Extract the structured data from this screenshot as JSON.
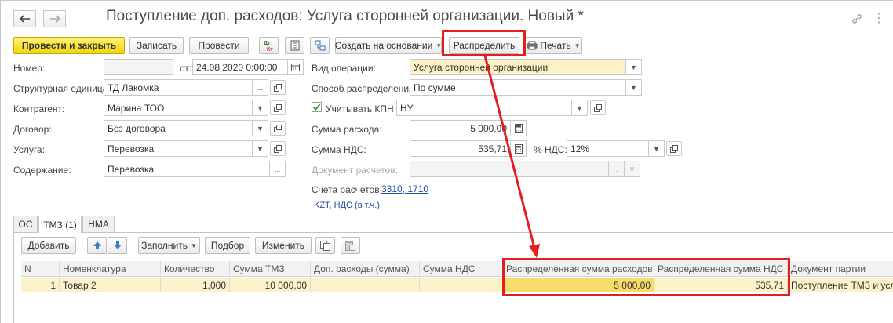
{
  "window": {
    "title": "Поступление доп. расходов: Услуга сторонней организации. Новый *"
  },
  "toolbar": {
    "post_close_label": "Провести и закрыть",
    "save_label": "Записать",
    "post_label": "Провести",
    "create_based_label": "Создать на основании",
    "distribute_label": "Распределить",
    "print_label": "Печать"
  },
  "form": {
    "number": {
      "label": "Номер:",
      "value": ""
    },
    "date": {
      "label": "от:",
      "value": "24.08.2020  0:00:00"
    },
    "structural_unit": {
      "label": "Структурная единица:",
      "value": "ТД Лакомка"
    },
    "counterparty": {
      "label": "Контрагент:",
      "value": "Марина ТОО"
    },
    "contract": {
      "label": "Договор:",
      "value": "Без договора"
    },
    "service": {
      "label": "Услуга:",
      "value": "Перевозка"
    },
    "content": {
      "label": "Содержание:",
      "value": "Перевозка"
    },
    "operation_type": {
      "label": "Вид операции:",
      "value": "Услуга сторонней организации"
    },
    "distribution_method": {
      "label": "Способ распределения:",
      "value": "По сумме"
    },
    "consider_kpn": {
      "label": "Учитывать КПН",
      "checked": true,
      "value": "НУ"
    },
    "expense_amount": {
      "label": "Сумма расхода:",
      "value": "5 000,00"
    },
    "vat_amount": {
      "label": "Сумма НДС:",
      "value": "535,71"
    },
    "vat_percent": {
      "label": "% НДС:",
      "value": "12%"
    },
    "settlement_document": {
      "label": "Документ расчетов:",
      "value": ""
    },
    "settlement_accounts": {
      "label": "Счета расчетов:",
      "value": "3310, 1710"
    },
    "currency_link": "KZT, НДС (в т.ч.)"
  },
  "tabs": [
    {
      "label": "ОС"
    },
    {
      "label": "ТМЗ (1)"
    },
    {
      "label": "НМА"
    }
  ],
  "table_toolbar": {
    "add_label": "Добавить",
    "fill_label": "Заполнить",
    "selection_label": "Подбор",
    "change_label": "Изменить"
  },
  "table": {
    "columns": [
      "N",
      "Номенклатура",
      "Количество",
      "Сумма ТМЗ",
      "Доп. расходы (сумма)",
      "Сумма НДС",
      "Распределенная сумма расходов",
      "Распределенная сумма НДС",
      "Документ партии"
    ],
    "rows": [
      [
        "1",
        "Товар 2",
        "1,000",
        "10 000,00",
        "",
        "",
        "5 000,00",
        "535,71",
        "Поступление ТМЗ и услуг"
      ]
    ]
  },
  "colors": {
    "primary_button": "#f2d40a",
    "highlight": "#e31e1e",
    "link": "#1f4ea0",
    "selected_row": "#fbf2cc"
  }
}
